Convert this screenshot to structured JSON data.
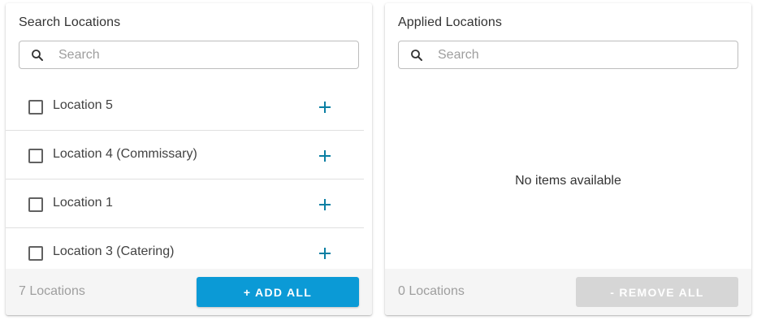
{
  "search_panel": {
    "title": "Search Locations",
    "search_placeholder": "Search",
    "items": [
      {
        "label": "Location 5"
      },
      {
        "label": "Location 4 (Commissary)"
      },
      {
        "label": "Location 1"
      },
      {
        "label": "Location 3 (Catering)"
      }
    ],
    "count_label": "7 Locations",
    "add_all_label": "+ ADD ALL"
  },
  "applied_panel": {
    "title": "Applied Locations",
    "search_placeholder": "Search",
    "empty_label": "No items available",
    "count_label": "0 Locations",
    "remove_all_label": "- REMOVE ALL"
  },
  "colors": {
    "accent": "#0b9ad6",
    "plus_icon": "#0a7fa3",
    "disabled_button": "#d6d6d6",
    "footer_bg": "#f5f5f5"
  },
  "icons": {
    "search": "search-icon",
    "add": "plus-icon",
    "checkbox": "checkbox-unchecked"
  }
}
